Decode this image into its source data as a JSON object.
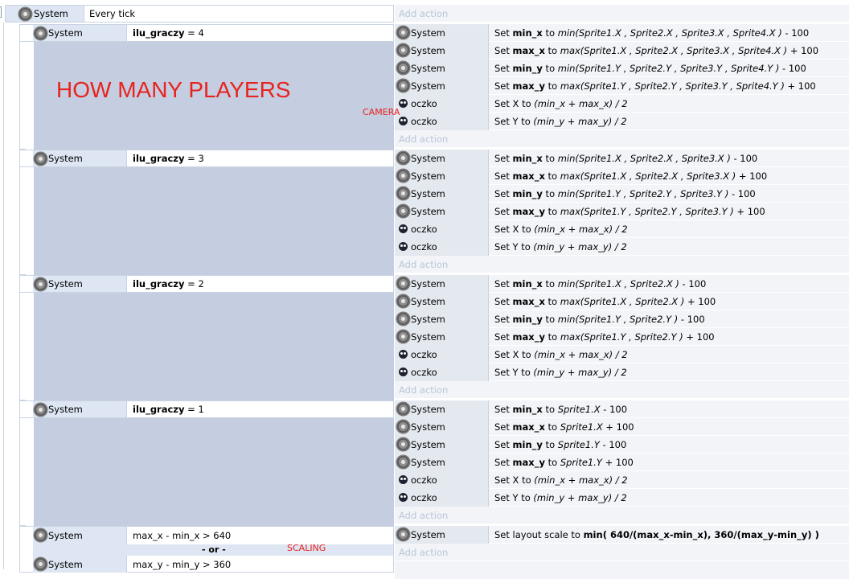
{
  "top_event": {
    "object": "System",
    "condition": "Every tick",
    "add_action": "Add action"
  },
  "labels": {
    "how_many_players": "HOW MANY PLAYERS",
    "camera": "CAMERA",
    "scaling": "SCALING"
  },
  "subevents": [
    {
      "object": "System",
      "var": "ilu_graczy",
      "op": " = 4",
      "add_action": "Add action",
      "actions": [
        {
          "obj": "System",
          "icon": "gear-icon",
          "pre": "Set ",
          "var": "min_x",
          "mid": " to ",
          "expr": "min(Sprite1.X , Sprite2.X , Sprite3.X , Sprite4.X )",
          "post": "  - 100"
        },
        {
          "obj": "System",
          "icon": "gear-icon",
          "pre": "Set ",
          "var": "max_x",
          "mid": " to ",
          "expr": "max(Sprite1.X , Sprite2.X , Sprite3.X , Sprite4.X )",
          "post": "  + 100"
        },
        {
          "obj": "System",
          "icon": "gear-icon",
          "pre": "Set ",
          "var": "min_y",
          "mid": " to ",
          "expr": "min(Sprite1.Y , Sprite2.Y , Sprite3.Y , Sprite4.Y )",
          "post": "  - 100"
        },
        {
          "obj": "System",
          "icon": "gear-icon",
          "pre": "Set ",
          "var": "max_y",
          "mid": " to ",
          "expr": "max(Sprite1.Y , Sprite2.Y , Sprite3.Y , Sprite4.Y )",
          "post": "  + 100"
        },
        {
          "obj": "oczko",
          "icon": "oczko-sprite-icon",
          "pre": "Set X to ",
          "var": "",
          "mid": "",
          "expr": "(min_x + max_x) / 2",
          "post": ""
        },
        {
          "obj": "oczko",
          "icon": "oczko-sprite-icon",
          "pre": "Set Y to ",
          "var": "",
          "mid": "",
          "expr": "(min_y + max_y) / 2",
          "post": ""
        }
      ]
    },
    {
      "object": "System",
      "var": "ilu_graczy",
      "op": " = 3",
      "add_action": "Add action",
      "actions": [
        {
          "obj": "System",
          "icon": "gear-icon",
          "pre": "Set ",
          "var": "min_x",
          "mid": " to ",
          "expr": "min(Sprite1.X , Sprite2.X , Sprite3.X )",
          "post": "  - 100"
        },
        {
          "obj": "System",
          "icon": "gear-icon",
          "pre": "Set ",
          "var": "max_x",
          "mid": " to ",
          "expr": "max(Sprite1.X , Sprite2.X , Sprite3.X  )",
          "post": "  + 100"
        },
        {
          "obj": "System",
          "icon": "gear-icon",
          "pre": "Set ",
          "var": "min_y",
          "mid": " to ",
          "expr": "min(Sprite1.Y , Sprite2.Y , Sprite3.Y  )",
          "post": "  - 100"
        },
        {
          "obj": "System",
          "icon": "gear-icon",
          "pre": "Set ",
          "var": "max_y",
          "mid": " to ",
          "expr": "max(Sprite1.Y , Sprite2.Y , Sprite3.Y  )",
          "post": "  + 100"
        },
        {
          "obj": "oczko",
          "icon": "oczko-sprite-icon",
          "pre": "Set X to ",
          "var": "",
          "mid": "",
          "expr": "(min_x + max_x) / 2",
          "post": ""
        },
        {
          "obj": "oczko",
          "icon": "oczko-sprite-icon",
          "pre": "Set Y to ",
          "var": "",
          "mid": "",
          "expr": "(min_y + max_y) / 2",
          "post": ""
        }
      ]
    },
    {
      "object": "System",
      "var": "ilu_graczy",
      "op": " = 2",
      "add_action": "Add action",
      "actions": [
        {
          "obj": "System",
          "icon": "gear-icon",
          "pre": "Set ",
          "var": "min_x",
          "mid": " to ",
          "expr": "min(Sprite1.X , Sprite2.X  )",
          "post": "  - 100"
        },
        {
          "obj": "System",
          "icon": "gear-icon",
          "pre": "Set ",
          "var": "max_x",
          "mid": " to ",
          "expr": "max(Sprite1.X , Sprite2.X  )",
          "post": "  + 100"
        },
        {
          "obj": "System",
          "icon": "gear-icon",
          "pre": "Set ",
          "var": "min_y",
          "mid": " to ",
          "expr": "min(Sprite1.Y , Sprite2.Y )",
          "post": "  - 100"
        },
        {
          "obj": "System",
          "icon": "gear-icon",
          "pre": "Set ",
          "var": "max_y",
          "mid": " to ",
          "expr": "max(Sprite1.Y , Sprite2.Y )",
          "post": "  + 100"
        },
        {
          "obj": "oczko",
          "icon": "oczko-sprite-icon",
          "pre": "Set X to ",
          "var": "",
          "mid": "",
          "expr": "(min_x + max_x) / 2",
          "post": ""
        },
        {
          "obj": "oczko",
          "icon": "oczko-sprite-icon",
          "pre": "Set Y to ",
          "var": "",
          "mid": "",
          "expr": "(min_y + max_y) / 2",
          "post": ""
        }
      ]
    },
    {
      "object": "System",
      "var": "ilu_graczy",
      "op": " = 1",
      "add_action": "Add action",
      "actions": [
        {
          "obj": "System",
          "icon": "gear-icon",
          "pre": "Set ",
          "var": "min_x",
          "mid": " to ",
          "expr": "Sprite1.X",
          "post": "  - 100"
        },
        {
          "obj": "System",
          "icon": "gear-icon",
          "pre": "Set ",
          "var": "max_x",
          "mid": " to ",
          "expr": "Sprite1.X",
          "post": " + 100"
        },
        {
          "obj": "System",
          "icon": "gear-icon",
          "pre": "Set ",
          "var": "min_y",
          "mid": " to ",
          "expr": "Sprite1.Y",
          "post": "  - 100"
        },
        {
          "obj": "System",
          "icon": "gear-icon",
          "pre": "Set ",
          "var": "max_y",
          "mid": " to ",
          "expr": "Sprite1.Y",
          "post": " + 100"
        },
        {
          "obj": "oczko",
          "icon": "oczko-sprite-icon",
          "pre": "Set X to ",
          "var": "",
          "mid": "",
          "expr": "(min_x + max_x) / 2",
          "post": ""
        },
        {
          "obj": "oczko",
          "icon": "oczko-sprite-icon",
          "pre": "Set Y to ",
          "var": "",
          "mid": "",
          "expr": "(min_y + max_y) / 2",
          "post": ""
        }
      ]
    }
  ],
  "scaling_event": {
    "cond1_object": "System",
    "cond1": "max_x - min_x > 640",
    "or_label": "- or -",
    "cond2_object": "System",
    "cond2": "max_y - min_y > 360",
    "action_object": "System",
    "action_pre": "Set layout scale to ",
    "action_expr": "min(  640/(max_x-min_x),  360/(max_y-min_y) )",
    "add_action": "Add action"
  }
}
